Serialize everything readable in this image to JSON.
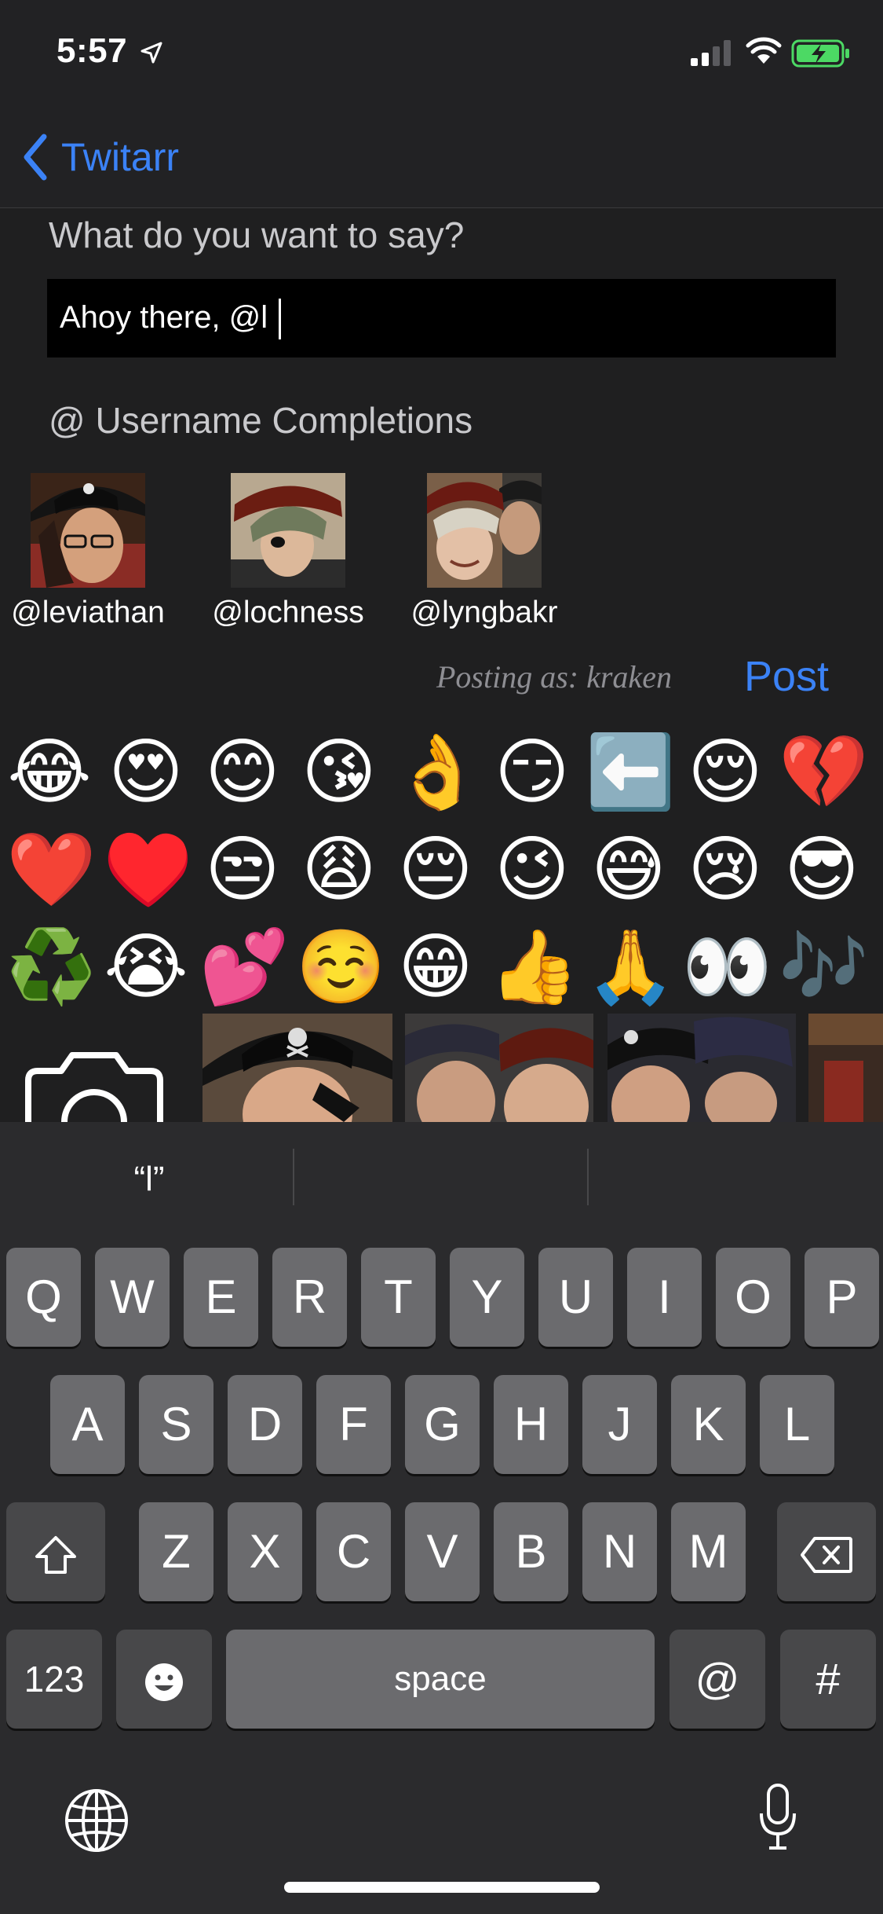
{
  "status_bar": {
    "time": "5:57"
  },
  "nav": {
    "back_label": "Twitarr"
  },
  "compose": {
    "prompt": "What do you want to say?",
    "text": "Ahoy there, @l"
  },
  "completions": {
    "title": "@ Username Completions",
    "users": [
      {
        "handle": "@leviathan"
      },
      {
        "handle": "@lochness"
      },
      {
        "handle": "@lyngbakr"
      }
    ]
  },
  "posting": {
    "as_label": "Posting as: kraken",
    "post_label": "Post"
  },
  "emoji_rows": [
    [
      "😂",
      "😍",
      "😊",
      "😘",
      "👌",
      "😏",
      "⬅️",
      "😌",
      "💔"
    ],
    [
      "❤️",
      "♥️",
      "😒",
      "😩",
      "😔",
      "😉",
      "😅",
      "😢",
      "😎"
    ],
    [
      "♻️",
      "😭",
      "💕",
      "☺️",
      "😁",
      "👍",
      "🙏",
      "👀",
      "🎶"
    ]
  ],
  "keyboard": {
    "suggestion": "“l”",
    "row1": [
      "Q",
      "W",
      "E",
      "R",
      "T",
      "Y",
      "U",
      "I",
      "O",
      "P"
    ],
    "row2": [
      "A",
      "S",
      "D",
      "F",
      "G",
      "H",
      "J",
      "K",
      "L"
    ],
    "row3": [
      "Z",
      "X",
      "C",
      "V",
      "B",
      "N",
      "M"
    ],
    "numbers_label": "123",
    "space_label": "space",
    "at_label": "@",
    "hash_label": "#"
  },
  "icons": {
    "back": "chevron-left-icon",
    "camera": "camera-icon",
    "globe": "globe-icon",
    "mic": "microphone-icon",
    "shift": "shift-icon",
    "delete": "delete-icon",
    "emoji": "emoji-icon"
  },
  "colors": {
    "accent": "#3b82f6",
    "background": "#1f1f20",
    "key": "#6b6b6e",
    "key_dark": "#48484a"
  }
}
